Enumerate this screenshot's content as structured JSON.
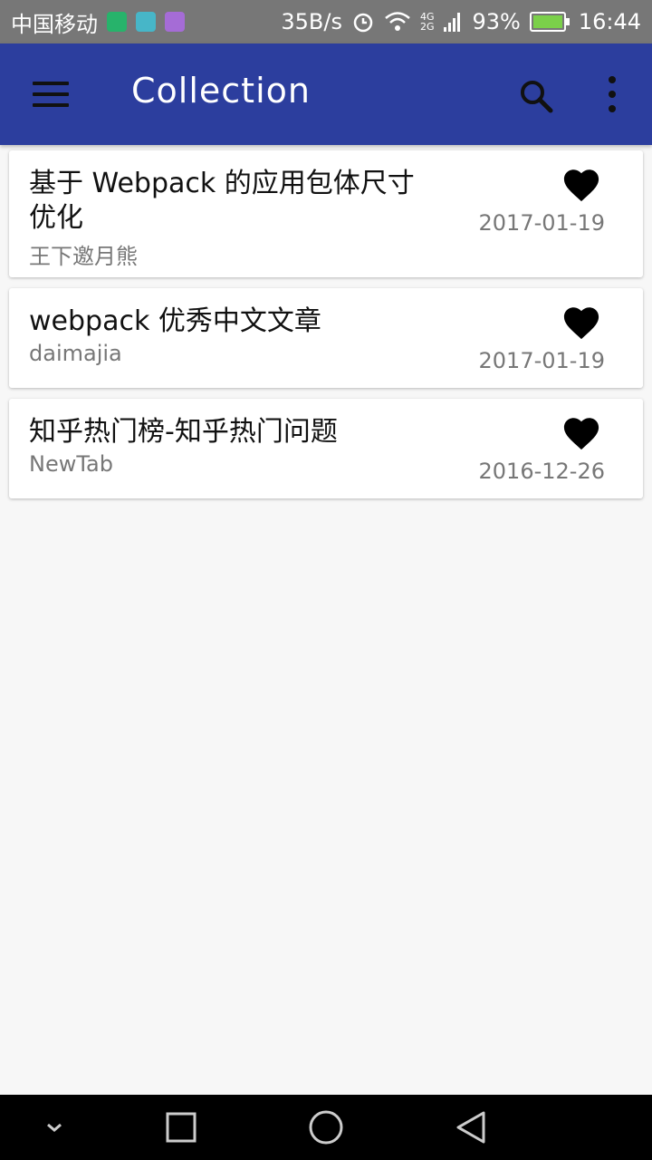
{
  "status_bar": {
    "carrier": "中国移动",
    "network_speed": "35B/s",
    "net_4g": "4G",
    "net_2g": "2G",
    "battery": "93%",
    "time": "16:44",
    "icons": [
      "app-icon-green",
      "app-icon-android",
      "app-icon-gallery",
      "alarm-icon",
      "wifi-icon",
      "signal-icon",
      "battery-icon"
    ]
  },
  "app_bar": {
    "title": "Collection",
    "color": "#2c3e9e",
    "icons": [
      "menu-icon",
      "search-icon",
      "more-vert-icon"
    ]
  },
  "items": [
    {
      "title": "基于 Webpack 的应用包体尺寸优化",
      "source": "王下邀月熊",
      "date": "2017-01-19",
      "favorited": true
    },
    {
      "title": "webpack 优秀中文文章",
      "source": "daimajia",
      "date": "2017-01-19",
      "favorited": true
    },
    {
      "title": "知乎热门榜-知乎热门问题",
      "source": "NewTab",
      "date": "2016-12-26",
      "favorited": true
    }
  ],
  "nav_bar": {
    "icons": [
      "hide-nav-icon",
      "recents-icon",
      "home-icon",
      "back-icon"
    ]
  }
}
